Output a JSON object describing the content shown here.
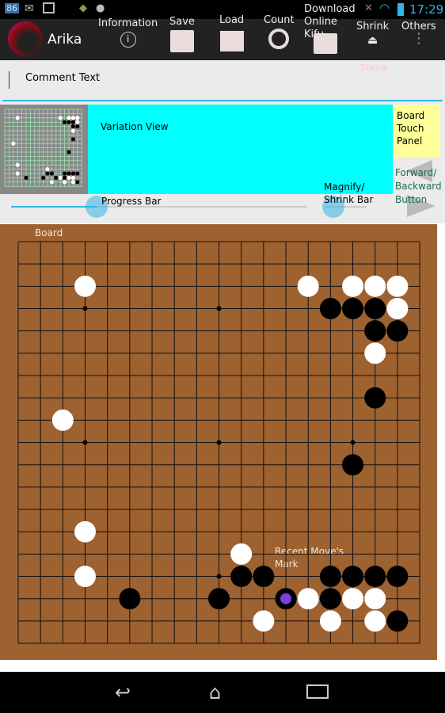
{
  "status_bar": {
    "badge": "86",
    "time": "17:29"
  },
  "action_bar": {
    "app_title": "Arika",
    "actions": [
      {
        "label": "Information",
        "icon": "info-icon"
      },
      {
        "label": "Save",
        "icon": "save-icon"
      },
      {
        "label": "Load",
        "icon": "folder-icon"
      },
      {
        "label": "Count",
        "icon": "target-icon"
      },
      {
        "label": "Download Online Kifu",
        "icon": "download-tray-icon"
      },
      {
        "label": "Shrink",
        "icon": "eject-icon"
      },
      {
        "label": "Others",
        "icon": "overflow-menu-icon"
      }
    ],
    "shrink_hint": "Shrink"
  },
  "comment": {
    "label": "Comment Text"
  },
  "panel": {
    "variation_label": "Variation View",
    "touch_panel_label": "Board Touch Panel",
    "forward_backward_label": "Forward/ Backward Button",
    "progress_label": "Progress Bar",
    "magnify_label": "Magnify/ Shrink Bar",
    "progress_value": 0.29,
    "magnify_value": 0.2,
    "colors": {
      "variation_bg": "#00ffff",
      "touch_panel_bg": "#ffff99",
      "accent": "#33b5e5"
    }
  },
  "board": {
    "label": "Board",
    "recent_move_label": "Recent Move's Mark",
    "size": 19,
    "color": "#9e6130",
    "recent_move": [
      12,
      16
    ],
    "recent_mark_color": "#7b3fe4",
    "black": [
      [
        14,
        3
      ],
      [
        15,
        3
      ],
      [
        16,
        3
      ],
      [
        16,
        4
      ],
      [
        17,
        4
      ],
      [
        16,
        7
      ],
      [
        15,
        10
      ],
      [
        10,
        15
      ],
      [
        11,
        15
      ],
      [
        14,
        15
      ],
      [
        15,
        15
      ],
      [
        16,
        15
      ],
      [
        17,
        15
      ],
      [
        5,
        16
      ],
      [
        9,
        16
      ],
      [
        12,
        16
      ],
      [
        14,
        16
      ],
      [
        17,
        17
      ]
    ],
    "white": [
      [
        3,
        2
      ],
      [
        13,
        2
      ],
      [
        15,
        2
      ],
      [
        16,
        2
      ],
      [
        17,
        2
      ],
      [
        17,
        3
      ],
      [
        16,
        5
      ],
      [
        2,
        8
      ],
      [
        3,
        13
      ],
      [
        10,
        14
      ],
      [
        3,
        15
      ],
      [
        13,
        16
      ],
      [
        15,
        16
      ],
      [
        16,
        16
      ],
      [
        11,
        17
      ],
      [
        14,
        17
      ],
      [
        16,
        17
      ]
    ]
  }
}
